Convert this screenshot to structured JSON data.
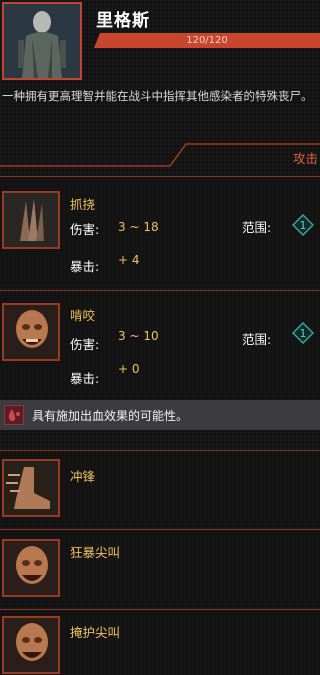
{
  "character": {
    "name": "里格斯",
    "hp_text": "120/120",
    "hp_fraction": 1.0,
    "description": "一种拥有更高理智并能在战斗中指挥其他感染者的特殊丧尸。"
  },
  "section": {
    "label": "攻击"
  },
  "skills": [
    {
      "name": "抓挠",
      "damage_label": "伤害:",
      "damage_value": "3 ~ 18",
      "crit_label": "暴击:",
      "crit_value": "+ 4",
      "range_label": "范围:",
      "range_value": "1",
      "icon": "claw-icon"
    },
    {
      "name": "啃咬",
      "damage_label": "伤害:",
      "damage_value": "3 ~ 10",
      "crit_label": "暴击:",
      "crit_value": "+ 0",
      "range_label": "范围:",
      "range_value": "1",
      "icon": "zombie-head-icon"
    }
  ],
  "effect": {
    "text": "具有施加出血效果的可能性。",
    "icon": "blood-drop-icon"
  },
  "abilities": [
    {
      "name": "冲锋",
      "icon": "charge-foot-icon"
    },
    {
      "name": "狂暴尖叫",
      "icon": "zombie-head-icon"
    },
    {
      "name": "掩护尖叫",
      "icon": "zombie-head-icon"
    }
  ],
  "colors": {
    "accent": "#c8462c",
    "title_gold": "#f2c15a",
    "range_teal": "#3aa39a"
  }
}
